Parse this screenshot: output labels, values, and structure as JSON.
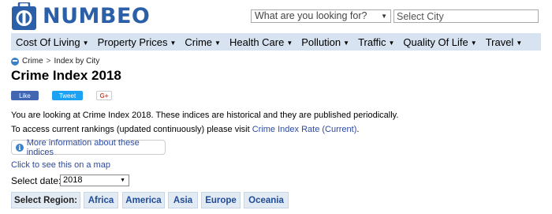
{
  "logo": {
    "text": "NUMBEO"
  },
  "search": {
    "placeholder": "What are you looking for?",
    "city_placeholder": "Select City"
  },
  "nav": [
    {
      "label": "Cost Of Living"
    },
    {
      "label": "Property Prices"
    },
    {
      "label": "Crime"
    },
    {
      "label": "Health Care"
    },
    {
      "label": "Pollution"
    },
    {
      "label": "Traffic"
    },
    {
      "label": "Quality Of Life"
    },
    {
      "label": "Travel"
    }
  ],
  "breadcrumb": {
    "items": [
      "Crime",
      "Index by City"
    ],
    "separator": ">"
  },
  "page": {
    "title": "Crime Index 2018",
    "social": {
      "like": "Like",
      "tweet": "Tweet",
      "gplus": "G+"
    },
    "para1": "You are looking at Crime Index 2018. These indices are historical and they are published periodically.",
    "para2_prefix": "To access current rankings (updated continuously) please visit ",
    "para2_link": "Crime Index Rate (Current)",
    "para2_suffix": ".",
    "more_info": "More information about these indices",
    "map_link": "Click to see this on a map",
    "date_label": "Select date:",
    "date_value": "2018"
  },
  "regions": {
    "label": "Select Region:",
    "items": [
      "Africa",
      "America",
      "Asia",
      "Europe",
      "Oceania"
    ]
  },
  "colors": {
    "brand": "#2b5fa8",
    "nav_bg": "#d7e3f0",
    "link": "#2d4aa0",
    "region_bg": "#e2eaf3"
  }
}
